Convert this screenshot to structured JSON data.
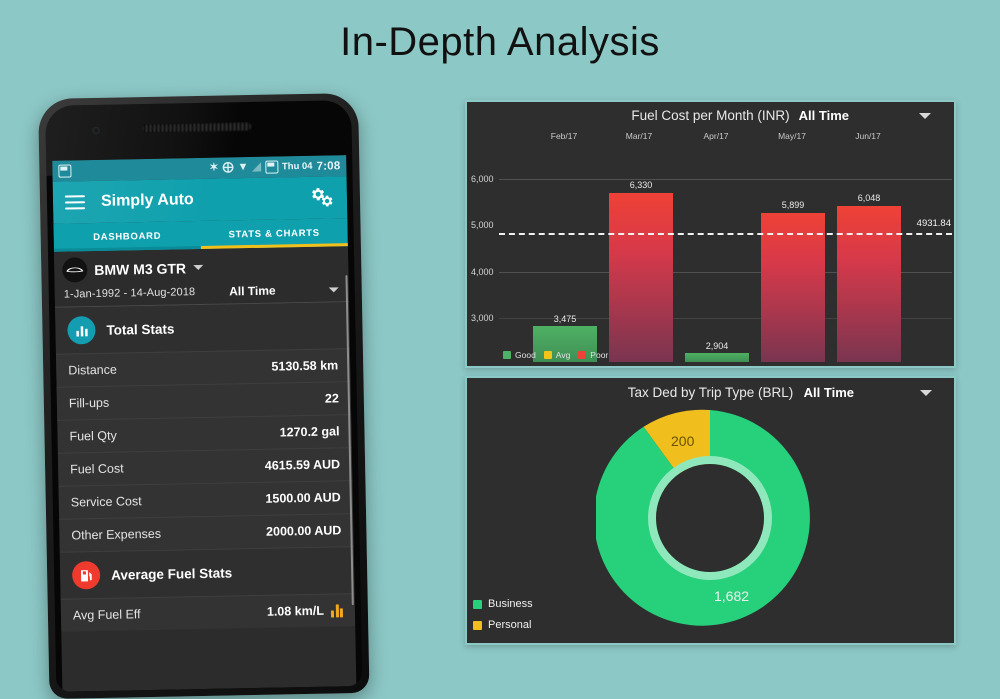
{
  "page": {
    "title": "In-Depth Analysis",
    "background_color": "#8cc8c6"
  },
  "phone": {
    "status_bar": {
      "left_icon": "screen-record-icon",
      "icons": [
        "bluetooth-icon",
        "location-icon",
        "wifi-icon",
        "signal-icon",
        "sd-card-icon"
      ],
      "day": "Thu 04",
      "time": "7:08",
      "background_color": "#1f8a99"
    },
    "app_bar": {
      "menu_icon": "hamburger-menu-icon",
      "title": "Simply Auto",
      "settings_icon": "gear-icon",
      "background_color": "#0fa0ad"
    },
    "tabs": [
      {
        "label": "DASHBOARD",
        "active": false
      },
      {
        "label": "STATS & CHARTS",
        "active": true
      }
    ],
    "tab_indicator_color": "#f2c01a",
    "vehicle": {
      "icon": "car-icon",
      "name": "BMW M3 GTR",
      "date_range": "1-Jan-1992  -  14-Aug-2018",
      "period": "All Time"
    },
    "sections": [
      {
        "icon": "bar-chart-icon",
        "icon_color": "#149cb0",
        "title": "Total Stats",
        "rows": [
          {
            "label": "Distance",
            "value": "5130.58 km"
          },
          {
            "label": "Fill-ups",
            "value": "22"
          },
          {
            "label": "Fuel Qty",
            "value": "1270.2 gal"
          },
          {
            "label": "Fuel Cost",
            "value": "4615.59 AUD"
          },
          {
            "label": "Service Cost",
            "value": "1500.00 AUD"
          },
          {
            "label": "Other Expenses",
            "value": "2000.00 AUD"
          }
        ]
      },
      {
        "icon": "fuel-pump-icon",
        "icon_color": "#ef3b2d",
        "title": "Average Fuel Stats",
        "rows": [
          {
            "label": "Avg Fuel Eff",
            "value": "1.08 km/L",
            "trailing_icon": "mini-bar-chart-icon"
          }
        ]
      }
    ]
  },
  "chart_data": [
    {
      "type": "bar",
      "title": "Fuel Cost per Month (INR)",
      "range_label": "All Time",
      "categories": [
        "Feb/17",
        "Mar/17",
        "Apr/17",
        "May/17",
        "Jun/17"
      ],
      "values": [
        3475,
        6330,
        2904,
        5899,
        6048
      ],
      "value_labels": [
        "3,475",
        "6,330",
        "2,904",
        "5,899",
        "6,048"
      ],
      "bar_classes": [
        "good",
        "poor",
        "good",
        "poor",
        "poor"
      ],
      "ylabel": "",
      "xlabel": "",
      "yticks": [
        3000,
        4000,
        5000,
        6000
      ],
      "ytick_labels": [
        "3,000",
        "4,000",
        "5,000",
        "6,000"
      ],
      "ylim": [
        2700,
        6600
      ],
      "average_line": 4931.84,
      "average_label": "4931.84",
      "grid": true,
      "legend_position": "bottom-left",
      "legend": [
        {
          "name": "Good",
          "color": "#4fb163"
        },
        {
          "name": "Avg",
          "color": "#f0c419"
        },
        {
          "name": "Poor",
          "color": "#ef4136"
        }
      ]
    },
    {
      "type": "pie",
      "title": "Tax Ded by Trip Type (BRL)",
      "range_label": "All Time",
      "categories": [
        "Business",
        "Personal"
      ],
      "values": [
        1682,
        200
      ],
      "value_labels": [
        "1,682",
        "200"
      ],
      "colors": [
        "#27d07a",
        "#f0bf1d"
      ],
      "legend_position": "bottom-left",
      "legend": [
        {
          "name": "Business",
          "color": "#27d07a"
        },
        {
          "name": "Personal",
          "color": "#f0bf1d"
        }
      ]
    }
  ]
}
